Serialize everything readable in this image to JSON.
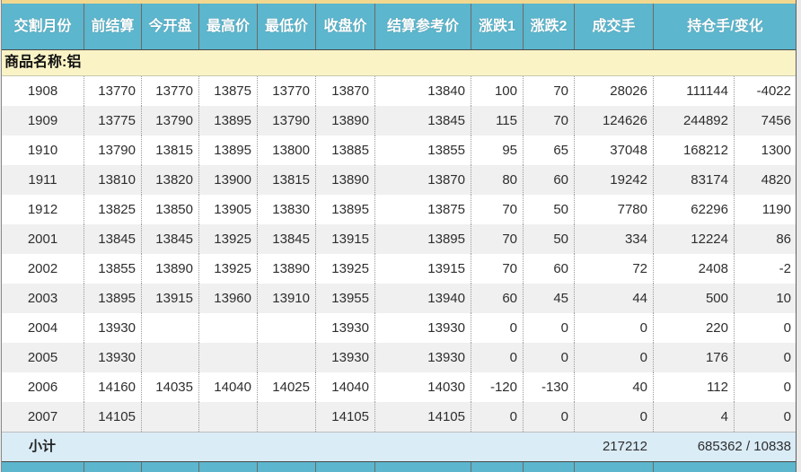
{
  "colors": {
    "header_bg": "#5cb6cd",
    "top_strip_bg": "#f2d88f",
    "product_row_bg": "#faf3c6",
    "subtotal_row_bg": "#daecf6",
    "alt_row_bg": "#f0f0f0",
    "gutter_bg": "#e9e9e9"
  },
  "table": {
    "columns": [
      {
        "key": "delivery-month",
        "label": "交割月份"
      },
      {
        "key": "prev-settlement",
        "label": "前结算"
      },
      {
        "key": "open",
        "label": "今开盘"
      },
      {
        "key": "high",
        "label": "最高价"
      },
      {
        "key": "low",
        "label": "最低价"
      },
      {
        "key": "close",
        "label": "收盘价"
      },
      {
        "key": "settlement-ref",
        "label": "结算参考价"
      },
      {
        "key": "change1",
        "label": "涨跌1"
      },
      {
        "key": "change2",
        "label": "涨跌2"
      },
      {
        "key": "volume",
        "label": "成交手"
      },
      {
        "key": "oi-and-change",
        "label": "持仓手/变化"
      }
    ],
    "product_row": {
      "label": "商品名称:铝"
    },
    "rows": [
      {
        "month": "1908",
        "prev_settle": "13770",
        "open": "13770",
        "high": "13875",
        "low": "13770",
        "close": "13870",
        "settle_ref": "13840",
        "change1": "100",
        "change2": "70",
        "volume": "28026",
        "open_interest": "111144",
        "oi_change": "-4022"
      },
      {
        "month": "1909",
        "prev_settle": "13775",
        "open": "13790",
        "high": "13895",
        "low": "13790",
        "close": "13890",
        "settle_ref": "13845",
        "change1": "115",
        "change2": "70",
        "volume": "124626",
        "open_interest": "244892",
        "oi_change": "7456"
      },
      {
        "month": "1910",
        "prev_settle": "13790",
        "open": "13815",
        "high": "13895",
        "low": "13800",
        "close": "13885",
        "settle_ref": "13855",
        "change1": "95",
        "change2": "65",
        "volume": "37048",
        "open_interest": "168212",
        "oi_change": "1300"
      },
      {
        "month": "1911",
        "prev_settle": "13810",
        "open": "13820",
        "high": "13900",
        "low": "13815",
        "close": "13890",
        "settle_ref": "13870",
        "change1": "80",
        "change2": "60",
        "volume": "19242",
        "open_interest": "83174",
        "oi_change": "4820"
      },
      {
        "month": "1912",
        "prev_settle": "13825",
        "open": "13850",
        "high": "13905",
        "low": "13830",
        "close": "13895",
        "settle_ref": "13875",
        "change1": "70",
        "change2": "50",
        "volume": "7780",
        "open_interest": "62296",
        "oi_change": "1190"
      },
      {
        "month": "2001",
        "prev_settle": "13845",
        "open": "13845",
        "high": "13925",
        "low": "13845",
        "close": "13915",
        "settle_ref": "13895",
        "change1": "70",
        "change2": "50",
        "volume": "334",
        "open_interest": "12224",
        "oi_change": "86"
      },
      {
        "month": "2002",
        "prev_settle": "13855",
        "open": "13890",
        "high": "13925",
        "low": "13890",
        "close": "13925",
        "settle_ref": "13915",
        "change1": "70",
        "change2": "60",
        "volume": "72",
        "open_interest": "2408",
        "oi_change": "-2"
      },
      {
        "month": "2003",
        "prev_settle": "13895",
        "open": "13915",
        "high": "13960",
        "low": "13910",
        "close": "13955",
        "settle_ref": "13940",
        "change1": "60",
        "change2": "45",
        "volume": "44",
        "open_interest": "500",
        "oi_change": "10"
      },
      {
        "month": "2004",
        "prev_settle": "13930",
        "open": "",
        "high": "",
        "low": "",
        "close": "13930",
        "settle_ref": "13930",
        "change1": "0",
        "change2": "0",
        "volume": "0",
        "open_interest": "220",
        "oi_change": "0"
      },
      {
        "month": "2005",
        "prev_settle": "13930",
        "open": "",
        "high": "",
        "low": "",
        "close": "13930",
        "settle_ref": "13930",
        "change1": "0",
        "change2": "0",
        "volume": "0",
        "open_interest": "176",
        "oi_change": "0"
      },
      {
        "month": "2006",
        "prev_settle": "14160",
        "open": "14035",
        "high": "14040",
        "low": "14025",
        "close": "14040",
        "settle_ref": "14030",
        "change1": "-120",
        "change2": "-130",
        "volume": "40",
        "open_interest": "112",
        "oi_change": "0"
      },
      {
        "month": "2007",
        "prev_settle": "14105",
        "open": "",
        "high": "",
        "low": "",
        "close": "14105",
        "settle_ref": "14105",
        "change1": "0",
        "change2": "0",
        "volume": "0",
        "open_interest": "4",
        "oi_change": "0"
      }
    ],
    "subtotal": {
      "label": "小计",
      "volume_total": "217212",
      "oi_total": "685362 / 10838"
    }
  }
}
